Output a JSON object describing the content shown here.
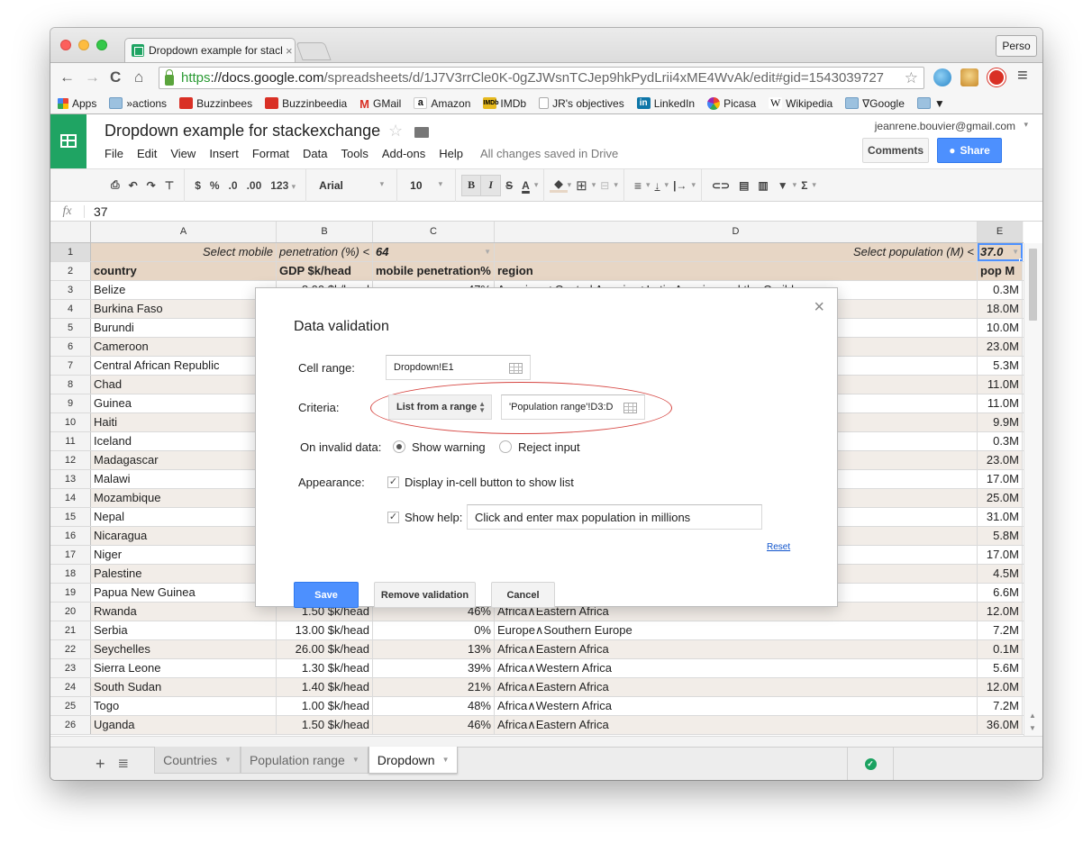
{
  "browser": {
    "tab_title": "Dropdown example for stackexchange",
    "tab_close": "×",
    "profile_label": "Perso",
    "url": {
      "scheme": "https",
      "host": "://docs.google.com",
      "path": "/spreadsheets/d/1J7V3rrCle0K-0gZJWsnTCJep9hkPydLrii4xME4WvAk/edit#gid=1543039727"
    },
    "nav": {
      "back": "←",
      "forward": "→",
      "reload": "C",
      "home": "⌂",
      "star": "☆",
      "menu": "≡"
    },
    "bookmarks": [
      {
        "label": "Apps",
        "icon": "apps-icon"
      },
      {
        "label": "»actions",
        "icon": "folder-icon"
      },
      {
        "label": "Buzzinbees",
        "icon": "buzzinbees-icon"
      },
      {
        "label": "Buzzinbeedia",
        "icon": "buzzinbeedia-icon"
      },
      {
        "label": "GMail",
        "icon": "gmail-icon",
        "glyph": "M"
      },
      {
        "label": "Amazon",
        "icon": "amazon-icon",
        "glyph": "a"
      },
      {
        "label": "IMDb",
        "icon": "imdb-icon",
        "glyph": "IMDb"
      },
      {
        "label": "JR's objectives",
        "icon": "page-icon"
      },
      {
        "label": "LinkedIn",
        "icon": "linkedin-icon",
        "glyph": "in"
      },
      {
        "label": "Picasa",
        "icon": "picasa-icon"
      },
      {
        "label": "Wikipedia",
        "icon": "wikipedia-icon",
        "glyph": "W"
      },
      {
        "label": "∇Google",
        "icon": "folder-icon"
      },
      {
        "label": "▼",
        "icon": "folder-icon"
      }
    ]
  },
  "docs": {
    "title": "Dropdown example for stackexchange",
    "star": "☆",
    "menu": [
      "File",
      "Edit",
      "View",
      "Insert",
      "Format",
      "Data",
      "Tools",
      "Add-ons",
      "Help"
    ],
    "save_status": "All changes saved in Drive",
    "user_email": "jeanrene.bouvier@gmail.com",
    "comments_label": "Comments",
    "share_label": "Share",
    "toolbar": {
      "currency": "$",
      "percent": "%",
      "dec_decrease": ".0",
      "dec_increase": ".00",
      "more_formats": "123",
      "font": "Arial",
      "font_size": "10",
      "bold": "B",
      "italic": "I",
      "strike": "S",
      "text_color": "A",
      "caret": "▾"
    },
    "formula": {
      "fx": "fx",
      "value": "37"
    }
  },
  "sheet": {
    "columns": [
      "A",
      "B",
      "C",
      "D",
      "E"
    ],
    "row1": {
      "num": "1",
      "a": "Select mobile",
      "b": "penetration (%) <",
      "c": "64",
      "d": "Select population (M) <",
      "e": "37.0"
    },
    "row2": {
      "num": "2",
      "a": "country",
      "b": "GDP $k/head",
      "c": "mobile penetration%",
      "d": "region",
      "e": "pop M"
    },
    "rows": [
      {
        "num": "3",
        "country": "Belize",
        "gdp": "8.00 $k/head",
        "mobile": "47%",
        "region": "Americas∧Central America∧Latin America and the Caribbean",
        "pop": "0.3M"
      },
      {
        "num": "4",
        "country": "Burkina Faso",
        "gdp": "",
        "mobile": "",
        "region": "",
        "pop": "18.0M"
      },
      {
        "num": "5",
        "country": "Burundi",
        "gdp": "",
        "mobile": "",
        "region": "",
        "pop": "10.0M"
      },
      {
        "num": "6",
        "country": "Cameroon",
        "gdp": "",
        "mobile": "",
        "region": "",
        "pop": "23.0M"
      },
      {
        "num": "7",
        "country": "Central African Republic",
        "gdp": "",
        "mobile": "",
        "region": "",
        "pop": "5.3M"
      },
      {
        "num": "8",
        "country": "Chad",
        "gdp": "",
        "mobile": "",
        "region": "",
        "pop": "11.0M"
      },
      {
        "num": "9",
        "country": "Guinea",
        "gdp": "",
        "mobile": "",
        "region": "",
        "pop": "11.0M"
      },
      {
        "num": "10",
        "country": "Haiti",
        "gdp": "",
        "mobile": "",
        "region": "",
        "pop": "9.9M"
      },
      {
        "num": "11",
        "country": "Iceland",
        "gdp": "",
        "mobile": "",
        "region": "",
        "pop": "0.3M"
      },
      {
        "num": "12",
        "country": "Madagascar",
        "gdp": "",
        "mobile": "",
        "region": "",
        "pop": "23.0M"
      },
      {
        "num": "13",
        "country": "Malawi",
        "gdp": "",
        "mobile": "",
        "region": "",
        "pop": "17.0M"
      },
      {
        "num": "14",
        "country": "Mozambique",
        "gdp": "",
        "mobile": "",
        "region": "",
        "pop": "25.0M"
      },
      {
        "num": "15",
        "country": "Nepal",
        "gdp": "",
        "mobile": "",
        "region": "",
        "pop": "31.0M"
      },
      {
        "num": "16",
        "country": "Nicaragua",
        "gdp": "",
        "mobile": "",
        "region": "",
        "pop": "5.8M"
      },
      {
        "num": "17",
        "country": "Niger",
        "gdp": "",
        "mobile": "",
        "region": "",
        "pop": "17.0M"
      },
      {
        "num": "18",
        "country": "Palestine",
        "gdp": "",
        "mobile": "",
        "region": "",
        "pop": "4.5M"
      },
      {
        "num": "19",
        "country": "Papua New Guinea",
        "gdp": "",
        "mobile": "",
        "region": "",
        "pop": "6.6M"
      },
      {
        "num": "20",
        "country": "Rwanda",
        "gdp": "1.50 $k/head",
        "mobile": "46%",
        "region": "Africa∧Eastern Africa",
        "pop": "12.0M"
      },
      {
        "num": "21",
        "country": "Serbia",
        "gdp": "13.00 $k/head",
        "mobile": "0%",
        "region": "Europe∧Southern Europe",
        "pop": "7.2M"
      },
      {
        "num": "22",
        "country": "Seychelles",
        "gdp": "26.00 $k/head",
        "mobile": "13%",
        "region": "Africa∧Eastern Africa",
        "pop": "0.1M"
      },
      {
        "num": "23",
        "country": "Sierra Leone",
        "gdp": "1.30 $k/head",
        "mobile": "39%",
        "region": "Africa∧Western Africa",
        "pop": "5.6M"
      },
      {
        "num": "24",
        "country": "South Sudan",
        "gdp": "1.40 $k/head",
        "mobile": "21%",
        "region": "Africa∧Eastern Africa",
        "pop": "12.0M"
      },
      {
        "num": "25",
        "country": "Togo",
        "gdp": "1.00 $k/head",
        "mobile": "48%",
        "region": "Africa∧Western Africa",
        "pop": "7.2M"
      },
      {
        "num": "26",
        "country": "Uganda",
        "gdp": "1.50 $k/head",
        "mobile": "46%",
        "region": "Africa∧Eastern Africa",
        "pop": "36.0M"
      }
    ],
    "tabs": [
      {
        "label": "Countries",
        "active": false
      },
      {
        "label": "Population range",
        "active": false
      },
      {
        "label": "Dropdown",
        "active": true
      }
    ],
    "add_sheet": "+",
    "all_sheets": "≣",
    "status_icon": "✓"
  },
  "dialog": {
    "title": "Data validation",
    "close": "×",
    "cell_range_label": "Cell range:",
    "cell_range_value": "Dropdown!E1",
    "criteria_label": "Criteria:",
    "criteria_type": "List from a range",
    "criteria_range": "'Population range'!D3:D",
    "invalid_label": "On invalid data:",
    "invalid_options": [
      {
        "label": "Show warning",
        "selected": true
      },
      {
        "label": "Reject input",
        "selected": false
      }
    ],
    "appearance_label": "Appearance:",
    "display_button_label": "Display in-cell button to show list",
    "display_button_checked": true,
    "show_help_label": "Show help:",
    "show_help_checked": true,
    "help_text": "Click and enter max population in millions",
    "reset_label": "Reset",
    "save_label": "Save",
    "remove_label": "Remove validation",
    "cancel_label": "Cancel"
  }
}
